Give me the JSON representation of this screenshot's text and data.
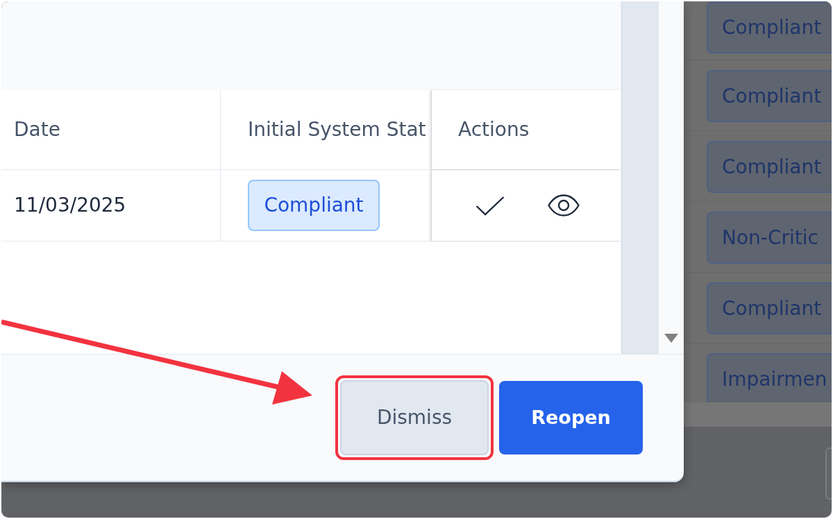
{
  "dialog": {
    "table": {
      "columns": [
        "Date",
        "Initial System Stat",
        "Actions"
      ],
      "rows": [
        {
          "date": "11/03/2025",
          "badge": "Compliant"
        }
      ]
    },
    "footer": {
      "buttons": [
        {
          "label": "Dismiss",
          "kind": "secondary",
          "highlighted": true
        },
        {
          "label": "Reopen",
          "kind": "primary",
          "highlighted": false
        }
      ]
    }
  },
  "background_page": {
    "status_badges": [
      "Compliant",
      "Compliant",
      "Compliant",
      "Non-Critic",
      "Compliant",
      "Impairmen"
    ]
  }
}
